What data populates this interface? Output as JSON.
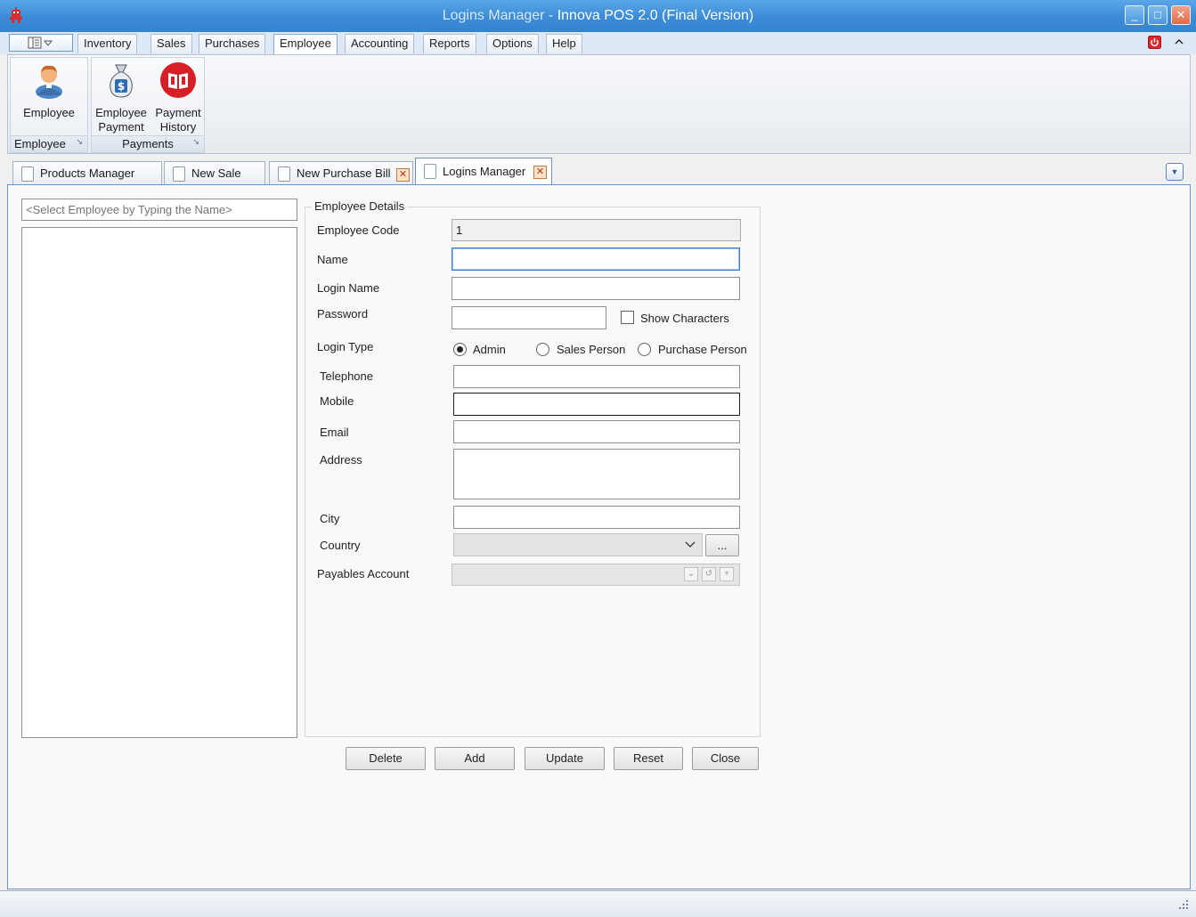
{
  "window": {
    "title_dim": "Logins Manager - ",
    "title_main": "Innova POS 2.0  (Final Version)",
    "minimize": "_",
    "maximize": "□",
    "close": "✕"
  },
  "ribbon_tabs": [
    "Inventory",
    "Sales",
    "Purchases",
    "Employee",
    "Accounting",
    "Reports",
    "Options",
    "Help"
  ],
  "active_ribbon_tab": "Employee",
  "ribbon": {
    "groups": [
      {
        "label": "Employee",
        "buttons": [
          {
            "label": "Employee",
            "icon": "employee-person-icon"
          }
        ]
      },
      {
        "label": "Payments",
        "buttons": [
          {
            "label": "Employee Payment",
            "icon": "money-bag-icon"
          },
          {
            "label": "Payment History",
            "icon": "red-book-icon"
          }
        ]
      }
    ],
    "launcher_glyph": "↘"
  },
  "doc_tabs": [
    {
      "label": "Products Manager",
      "closable": false,
      "active": false
    },
    {
      "label": "New Sale",
      "closable": false,
      "active": false
    },
    {
      "label": "New Purchase Bill",
      "closable": true,
      "active": false
    },
    {
      "label": "Logins Manager",
      "closable": true,
      "active": true
    }
  ],
  "tab_close_glyph": "✕",
  "employee_search": {
    "placeholder": "<Select Employee by Typing the Name>"
  },
  "details": {
    "group_title": "Employee Details",
    "employee_code": {
      "label": "Employee Code",
      "value": "1"
    },
    "name": {
      "label": "Name",
      "value": ""
    },
    "login_name": {
      "label": "Login Name",
      "value": ""
    },
    "password": {
      "label": "Password",
      "value": "",
      "show_characters": "Show Characters",
      "show_checked": false
    },
    "login_type": {
      "label": "Login Type",
      "options": [
        "Admin",
        "Sales Person",
        "Purchase Person"
      ],
      "selected": "Admin"
    },
    "telephone": {
      "label": "Telephone",
      "value": ""
    },
    "mobile": {
      "label": "Mobile",
      "value": ""
    },
    "email": {
      "label": "Email",
      "value": ""
    },
    "address": {
      "label": "Address",
      "value": ""
    },
    "city": {
      "label": "City",
      "value": ""
    },
    "country": {
      "label": "Country",
      "value": "",
      "browse": "..."
    },
    "payables_account": {
      "label": "Payables Account",
      "value": ""
    }
  },
  "actions": [
    "Delete",
    "Add",
    "Update",
    "Reset",
    "Close"
  ],
  "colors": {
    "titlebar": "#3b8bd6",
    "content_border": "#6c93c4",
    "power_button": "#d9262b"
  }
}
